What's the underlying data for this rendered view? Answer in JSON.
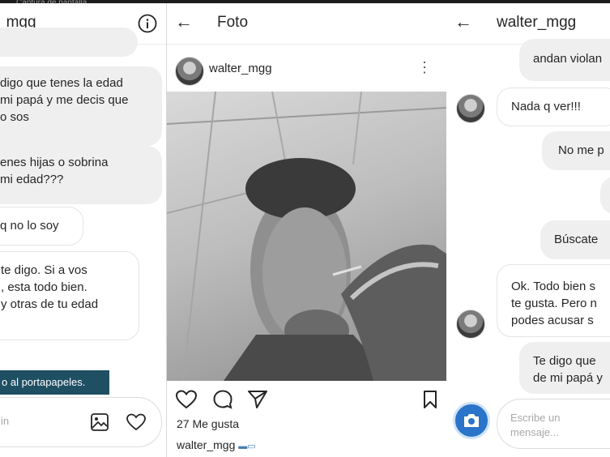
{
  "status_bar": {
    "faded_text": "Captura de pantalla"
  },
  "left_panel": {
    "header_title": "_mgg",
    "messages": [
      {
        "lines": [
          "digo que tenes la edad",
          "mi papá y me decis que",
          "o sos"
        ]
      },
      {
        "lines": [
          "enes hijas o sobrina",
          "mi edad???"
        ]
      },
      {
        "lines": [
          "q no lo soy"
        ]
      },
      {
        "lines": [
          "te digo. Si a vos",
          ", esta todo bien.",
          "y otras de tu edad"
        ]
      }
    ],
    "toast": "o al portapapeles.",
    "composer_placeholder": "in"
  },
  "middle_panel": {
    "header_title": "Foto",
    "post_username": "walter_mgg",
    "likes": "27 Me gusta",
    "caption_user": "walter_mgg",
    "caption_emoji": "▬▭"
  },
  "right_panel": {
    "header_title": "walter_mgg",
    "messages": [
      {
        "lines": [
          "andan violan"
        ]
      },
      {
        "lines": [
          "Nada q ver!!!"
        ]
      },
      {
        "lines": [
          "No me p"
        ]
      },
      {
        "lines": [
          "Búscate"
        ]
      },
      {
        "lines": [
          "Ok. Todo bien s",
          "te gusta. Pero n",
          "podes acusar s"
        ]
      },
      {
        "lines": [
          "Te digo que",
          "de mi papá y"
        ]
      }
    ],
    "composer_placeholder_line1": "Escribe un",
    "composer_placeholder_line2": "mensaje..."
  },
  "colors": {
    "toast": "#1f4f63",
    "camera": "#2a74c9",
    "bubble": "#efefef"
  },
  "icons": [
    "info-icon",
    "back-arrow-icon",
    "more-icon",
    "heart-icon",
    "comment-icon",
    "send-icon",
    "bookmark-icon",
    "gallery-icon",
    "camera-icon"
  ]
}
